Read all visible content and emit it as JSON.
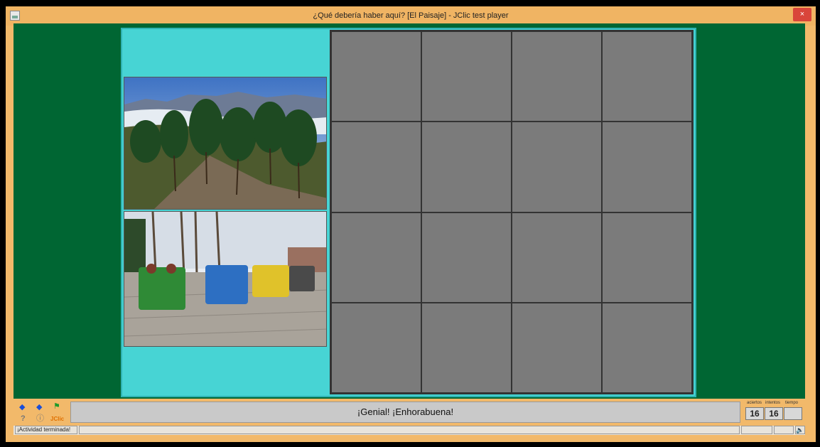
{
  "window": {
    "title": "¿Qué debería haber aquí? [El Paisaje] - JClic test player",
    "close_icon": "close-icon"
  },
  "activity": {
    "images": [
      {
        "name": "forest-landscape-image",
        "description_icon": "image"
      },
      {
        "name": "recycling-bins-image",
        "description_icon": "image"
      }
    ],
    "grid": {
      "rows": 4,
      "cols": 4
    }
  },
  "toolbar": {
    "icons": [
      "back-arrow-icon",
      "forward-arrow-icon",
      "reset-flag-icon",
      "help-icon",
      "info-icon",
      "jclic-logo-icon"
    ],
    "jclic_label": "JClic",
    "message": "¡Genial! ¡Enhorabuena!"
  },
  "counters": {
    "aciertos_label": "aciertos",
    "intentos_label": "intentos",
    "tiempo_label": "tiempo",
    "aciertos": "16",
    "intentos": "16",
    "tiempo": ""
  },
  "status": {
    "text": "¡Actividad terminada!",
    "sound_icon": "speaker-icon"
  },
  "colors": {
    "background": "#006633",
    "panel": "#47d4d4",
    "cells": "#7b7b7b",
    "frame": "#f2b96a"
  }
}
